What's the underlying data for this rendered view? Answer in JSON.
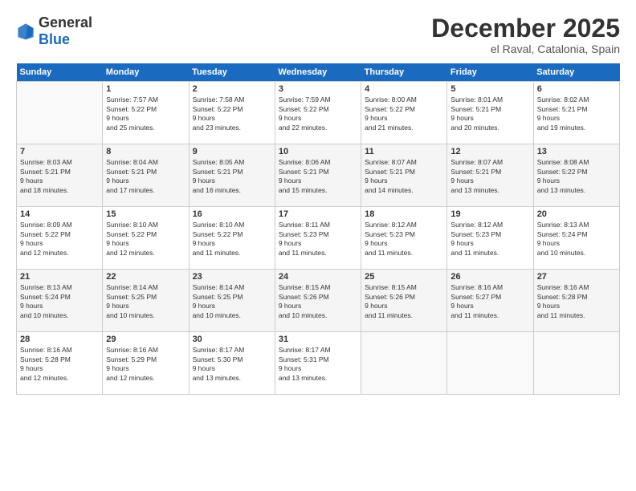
{
  "logo": {
    "general": "General",
    "blue": "Blue"
  },
  "title": {
    "month_year": "December 2025",
    "location": "el Raval, Catalonia, Spain"
  },
  "headers": [
    "Sunday",
    "Monday",
    "Tuesday",
    "Wednesday",
    "Thursday",
    "Friday",
    "Saturday"
  ],
  "weeks": [
    [
      {
        "day": "",
        "sunrise": "",
        "sunset": "",
        "daylight": ""
      },
      {
        "day": "1",
        "sunrise": "Sunrise: 7:57 AM",
        "sunset": "Sunset: 5:22 PM",
        "daylight": "Daylight: 9 hours and 25 minutes."
      },
      {
        "day": "2",
        "sunrise": "Sunrise: 7:58 AM",
        "sunset": "Sunset: 5:22 PM",
        "daylight": "Daylight: 9 hours and 23 minutes."
      },
      {
        "day": "3",
        "sunrise": "Sunrise: 7:59 AM",
        "sunset": "Sunset: 5:22 PM",
        "daylight": "Daylight: 9 hours and 22 minutes."
      },
      {
        "day": "4",
        "sunrise": "Sunrise: 8:00 AM",
        "sunset": "Sunset: 5:22 PM",
        "daylight": "Daylight: 9 hours and 21 minutes."
      },
      {
        "day": "5",
        "sunrise": "Sunrise: 8:01 AM",
        "sunset": "Sunset: 5:21 PM",
        "daylight": "Daylight: 9 hours and 20 minutes."
      },
      {
        "day": "6",
        "sunrise": "Sunrise: 8:02 AM",
        "sunset": "Sunset: 5:21 PM",
        "daylight": "Daylight: 9 hours and 19 minutes."
      }
    ],
    [
      {
        "day": "7",
        "sunrise": "Sunrise: 8:03 AM",
        "sunset": "Sunset: 5:21 PM",
        "daylight": "Daylight: 9 hours and 18 minutes."
      },
      {
        "day": "8",
        "sunrise": "Sunrise: 8:04 AM",
        "sunset": "Sunset: 5:21 PM",
        "daylight": "Daylight: 9 hours and 17 minutes."
      },
      {
        "day": "9",
        "sunrise": "Sunrise: 8:05 AM",
        "sunset": "Sunset: 5:21 PM",
        "daylight": "Daylight: 9 hours and 16 minutes."
      },
      {
        "day": "10",
        "sunrise": "Sunrise: 8:06 AM",
        "sunset": "Sunset: 5:21 PM",
        "daylight": "Daylight: 9 hours and 15 minutes."
      },
      {
        "day": "11",
        "sunrise": "Sunrise: 8:07 AM",
        "sunset": "Sunset: 5:21 PM",
        "daylight": "Daylight: 9 hours and 14 minutes."
      },
      {
        "day": "12",
        "sunrise": "Sunrise: 8:07 AM",
        "sunset": "Sunset: 5:21 PM",
        "daylight": "Daylight: 9 hours and 13 minutes."
      },
      {
        "day": "13",
        "sunrise": "Sunrise: 8:08 AM",
        "sunset": "Sunset: 5:22 PM",
        "daylight": "Daylight: 9 hours and 13 minutes."
      }
    ],
    [
      {
        "day": "14",
        "sunrise": "Sunrise: 8:09 AM",
        "sunset": "Sunset: 5:22 PM",
        "daylight": "Daylight: 9 hours and 12 minutes."
      },
      {
        "day": "15",
        "sunrise": "Sunrise: 8:10 AM",
        "sunset": "Sunset: 5:22 PM",
        "daylight": "Daylight: 9 hours and 12 minutes."
      },
      {
        "day": "16",
        "sunrise": "Sunrise: 8:10 AM",
        "sunset": "Sunset: 5:22 PM",
        "daylight": "Daylight: 9 hours and 11 minutes."
      },
      {
        "day": "17",
        "sunrise": "Sunrise: 8:11 AM",
        "sunset": "Sunset: 5:23 PM",
        "daylight": "Daylight: 9 hours and 11 minutes."
      },
      {
        "day": "18",
        "sunrise": "Sunrise: 8:12 AM",
        "sunset": "Sunset: 5:23 PM",
        "daylight": "Daylight: 9 hours and 11 minutes."
      },
      {
        "day": "19",
        "sunrise": "Sunrise: 8:12 AM",
        "sunset": "Sunset: 5:23 PM",
        "daylight": "Daylight: 9 hours and 11 minutes."
      },
      {
        "day": "20",
        "sunrise": "Sunrise: 8:13 AM",
        "sunset": "Sunset: 5:24 PM",
        "daylight": "Daylight: 9 hours and 10 minutes."
      }
    ],
    [
      {
        "day": "21",
        "sunrise": "Sunrise: 8:13 AM",
        "sunset": "Sunset: 5:24 PM",
        "daylight": "Daylight: 9 hours and 10 minutes."
      },
      {
        "day": "22",
        "sunrise": "Sunrise: 8:14 AM",
        "sunset": "Sunset: 5:25 PM",
        "daylight": "Daylight: 9 hours and 10 minutes."
      },
      {
        "day": "23",
        "sunrise": "Sunrise: 8:14 AM",
        "sunset": "Sunset: 5:25 PM",
        "daylight": "Daylight: 9 hours and 10 minutes."
      },
      {
        "day": "24",
        "sunrise": "Sunrise: 8:15 AM",
        "sunset": "Sunset: 5:26 PM",
        "daylight": "Daylight: 9 hours and 10 minutes."
      },
      {
        "day": "25",
        "sunrise": "Sunrise: 8:15 AM",
        "sunset": "Sunset: 5:26 PM",
        "daylight": "Daylight: 9 hours and 11 minutes."
      },
      {
        "day": "26",
        "sunrise": "Sunrise: 8:16 AM",
        "sunset": "Sunset: 5:27 PM",
        "daylight": "Daylight: 9 hours and 11 minutes."
      },
      {
        "day": "27",
        "sunrise": "Sunrise: 8:16 AM",
        "sunset": "Sunset: 5:28 PM",
        "daylight": "Daylight: 9 hours and 11 minutes."
      }
    ],
    [
      {
        "day": "28",
        "sunrise": "Sunrise: 8:16 AM",
        "sunset": "Sunset: 5:28 PM",
        "daylight": "Daylight: 9 hours and 12 minutes."
      },
      {
        "day": "29",
        "sunrise": "Sunrise: 8:16 AM",
        "sunset": "Sunset: 5:29 PM",
        "daylight": "Daylight: 9 hours and 12 minutes."
      },
      {
        "day": "30",
        "sunrise": "Sunrise: 8:17 AM",
        "sunset": "Sunset: 5:30 PM",
        "daylight": "Daylight: 9 hours and 13 minutes."
      },
      {
        "day": "31",
        "sunrise": "Sunrise: 8:17 AM",
        "sunset": "Sunset: 5:31 PM",
        "daylight": "Daylight: 9 hours and 13 minutes."
      },
      {
        "day": "",
        "sunrise": "",
        "sunset": "",
        "daylight": ""
      },
      {
        "day": "",
        "sunrise": "",
        "sunset": "",
        "daylight": ""
      },
      {
        "day": "",
        "sunrise": "",
        "sunset": "",
        "daylight": ""
      }
    ]
  ]
}
